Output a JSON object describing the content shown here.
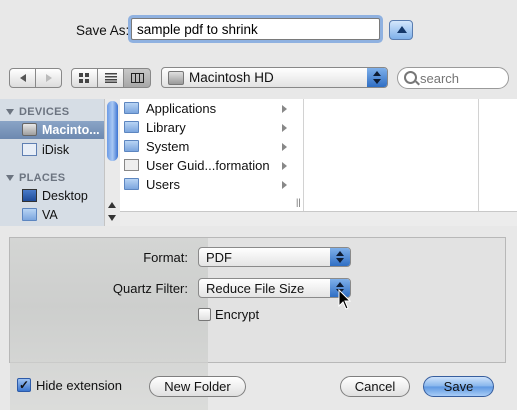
{
  "save_as": {
    "label": "Save As:",
    "value": "sample pdf to shrink"
  },
  "toolbar": {
    "location": "Macintosh HD",
    "search_placeholder": "search"
  },
  "sidebar": {
    "sections": [
      {
        "header": "DEVICES",
        "items": [
          {
            "label": "Macinto...",
            "icon": "hard-drive-icon",
            "selected": true
          },
          {
            "label": "iDisk",
            "icon": "idisk-icon",
            "selected": false
          }
        ]
      },
      {
        "header": "PLACES",
        "items": [
          {
            "label": "Desktop",
            "icon": "desktop-icon",
            "selected": false
          },
          {
            "label": "VA",
            "icon": "folder-icon",
            "selected": false
          }
        ]
      }
    ]
  },
  "browser": {
    "items": [
      "Applications",
      "Library",
      "System",
      "User Guid...formation",
      "Users"
    ]
  },
  "options": {
    "format_label": "Format:",
    "format_value": "PDF",
    "filter_label": "Quartz Filter:",
    "filter_value": "Reduce File Size",
    "encrypt_label": "Encrypt",
    "encrypt_checked": false
  },
  "footer": {
    "hide_extension_label": "Hide extension",
    "hide_extension_checked": true,
    "new_folder": "New Folder",
    "cancel": "Cancel",
    "save": "Save"
  },
  "colors": {
    "accent": "#6d89b0",
    "default_button": "#5d97e2"
  }
}
